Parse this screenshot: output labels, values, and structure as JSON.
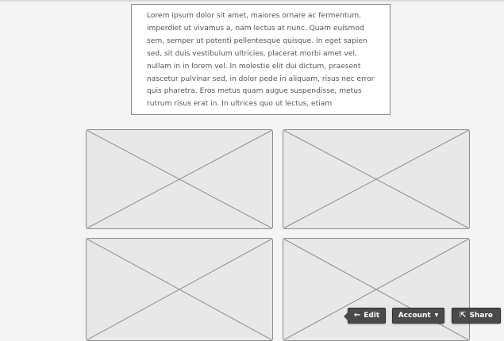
{
  "content": {
    "paragraph_lines": [
      "Lorem ipsum dolor sit amet, maiores ornare ac fermentum,",
      "imperdiet ut vivamus a, nam lectus at nunc. Quam euismod",
      "sem, semper ut potenti pellentesque quisque. In eget sapien",
      "sed, sit duis vestibulum ultricies, placerat morbi amet vel,",
      "nullam in in lorem vel. In molestie elit dui dictum, praesent",
      "nascetur pulvinar sed, in dolor pede in aliquam, risus nec error",
      "quis pharetra. Eros metus quam augue suspendisse, metus",
      "rutrum risus erat in.  In ultrices quo ut lectus, etiam"
    ]
  },
  "image_placeholders": [
    {
      "icon": "image-placeholder-x"
    },
    {
      "icon": "image-placeholder-x"
    },
    {
      "icon": "image-placeholder-x"
    },
    {
      "icon": "image-placeholder-x"
    }
  ],
  "toolbar": {
    "edit_label": "Edit",
    "edit_icon": "arrow-left-icon",
    "account_label": "Account",
    "account_icon": "caret-down-icon",
    "share_label": "Share",
    "share_icon": "share-icon"
  },
  "colors": {
    "page_background": "#f4f4f4",
    "text_box_background": "#ffffff",
    "placeholder_fill": "#e8e8e8",
    "placeholder_stroke": "#8c8c8c",
    "toolbar_button": "#4a4a4a",
    "toolbar_text": "#ffffff",
    "paragraph_text": "#555555"
  }
}
